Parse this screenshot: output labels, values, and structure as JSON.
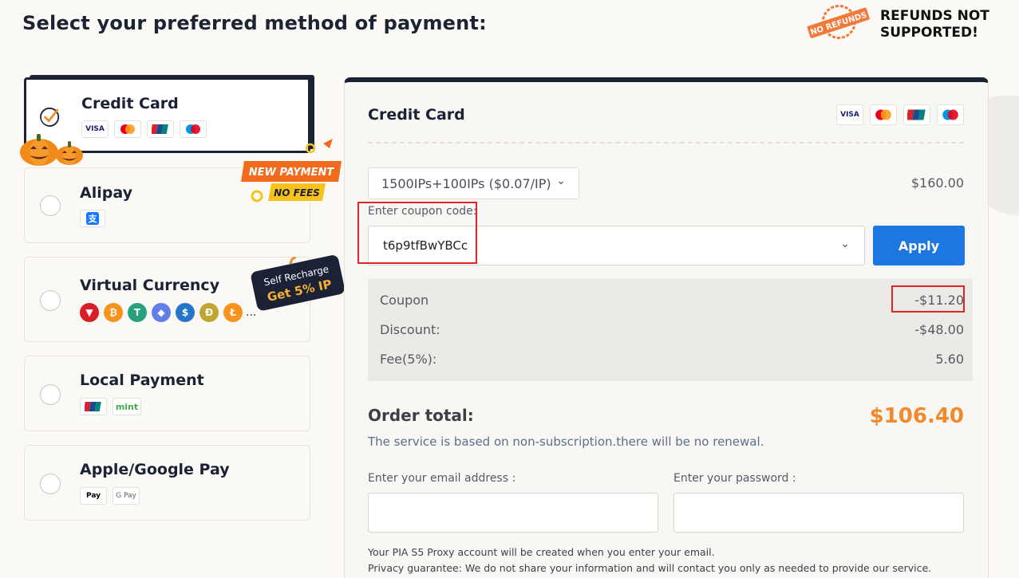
{
  "page": {
    "title": "Select your preferred method of payment:",
    "refund_stamp": "NO REFUNDS",
    "refund_notice_line1": "REFUNDS NOT",
    "refund_notice_line2": "SUPPORTED!"
  },
  "methods": [
    {
      "name": "Credit Card",
      "selected": true,
      "icons": [
        "VISA",
        "Mastercard",
        "UnionPay",
        "Maestro"
      ]
    },
    {
      "name": "Alipay",
      "selected": false,
      "icons": [
        "Alipay"
      ]
    },
    {
      "name": "Virtual Currency",
      "selected": false,
      "icons": [
        "TRON",
        "Bitcoin",
        "Tether",
        "Ethereum",
        "USD Coin",
        "Dogecoin",
        "Litecoin"
      ],
      "more": "..."
    },
    {
      "name": "Local Payment",
      "selected": false,
      "icons": [
        "UnionPay",
        "mint"
      ]
    },
    {
      "name": "Apple/Google Pay",
      "selected": false,
      "icons": [
        "Apple Pay",
        "Google Pay"
      ]
    }
  ],
  "promos": {
    "new_payment": "NEW PAYMENT",
    "no_fees": "NO FEES",
    "self_recharge": "Self Recharge",
    "get_ip": "Get 5% IP"
  },
  "panel": {
    "title": "Credit Card",
    "package": "1500IPs+100IPs ($0.07/IP)",
    "package_price": "$160.00",
    "coupon_label": "Enter coupon code:",
    "coupon_value": "t6p9tfBwYBCc",
    "apply_label": "Apply",
    "summary": [
      {
        "label": "Coupon",
        "value": "-$11.20"
      },
      {
        "label": "Discount:",
        "value": "-$48.00"
      },
      {
        "label": "Fee(5%):",
        "value": "5.60"
      }
    ],
    "order_total_label": "Order total:",
    "order_total_value": "$106.40",
    "note": "The service is based on non-subscription.there will be no renewal.",
    "email_label": "Enter your email address :",
    "password_label": "Enter your password :",
    "footnote_1": "Your PIA S5 Proxy account will be created when you enter your email.",
    "footnote_2": "Privacy guarantee: We do not share your information and will contact you only as needed to provide our service."
  },
  "colors": {
    "accent_orange": "#f08a2c",
    "apply_blue": "#1c78e0",
    "navy": "#1b2236",
    "highlight_red": "#e0252a"
  }
}
